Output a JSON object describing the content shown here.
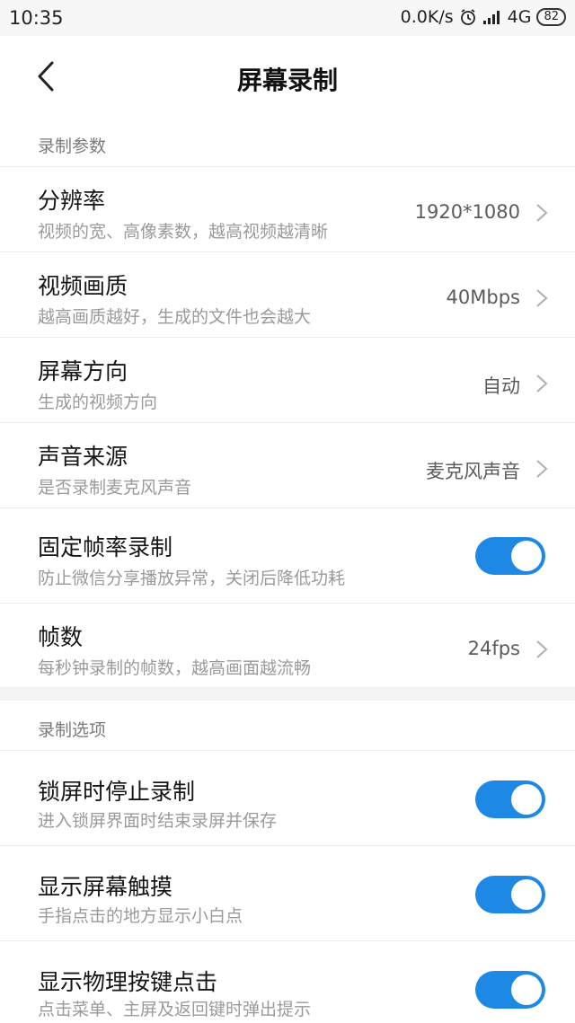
{
  "status_bar": {
    "time": "10:35",
    "speed": "0.0K/s",
    "network": "4G",
    "battery": "82",
    "icons": [
      "alarm-icon",
      "signal-icon",
      "battery-icon"
    ]
  },
  "header": {
    "title": "屏幕录制",
    "back_icon": "chevron-left-icon"
  },
  "sections": [
    {
      "title": "录制参数",
      "items": [
        {
          "title": "分辨率",
          "subtitle": "视频的宽、高像素数，越高视频越清晰",
          "value": "1920*1080",
          "type": "select"
        },
        {
          "title": "视频画质",
          "subtitle": "越高画质越好，生成的文件也会越大",
          "value": "40Mbps",
          "type": "select"
        },
        {
          "title": "屏幕方向",
          "subtitle": "生成的视频方向",
          "value": "自动",
          "type": "select"
        },
        {
          "title": "声音来源",
          "subtitle": "是否录制麦克风声音",
          "value": "麦克风声音",
          "type": "select"
        },
        {
          "title": "固定帧率录制",
          "subtitle": "防止微信分享播放异常，关闭后降低功耗",
          "value": "on",
          "type": "toggle"
        },
        {
          "title": "帧数",
          "subtitle": "每秒钟录制的帧数，越高画面越流畅",
          "value": "24fps",
          "type": "select"
        }
      ]
    },
    {
      "title": "录制选项",
      "items": [
        {
          "title": "锁屏时停止录制",
          "subtitle": "进入锁屏界面时结束录屏并保存",
          "value": "on",
          "type": "toggle"
        },
        {
          "title": "显示屏幕触摸",
          "subtitle": "手指点击的地方显示小白点",
          "value": "on",
          "type": "toggle"
        },
        {
          "title": "显示物理按键点击",
          "subtitle": "点击菜单、主屏及返回键时弹出提示",
          "value": "on",
          "type": "toggle"
        }
      ]
    }
  ],
  "colors": {
    "accent": "#1e88e5",
    "section_bg": "#f4f4f4"
  }
}
